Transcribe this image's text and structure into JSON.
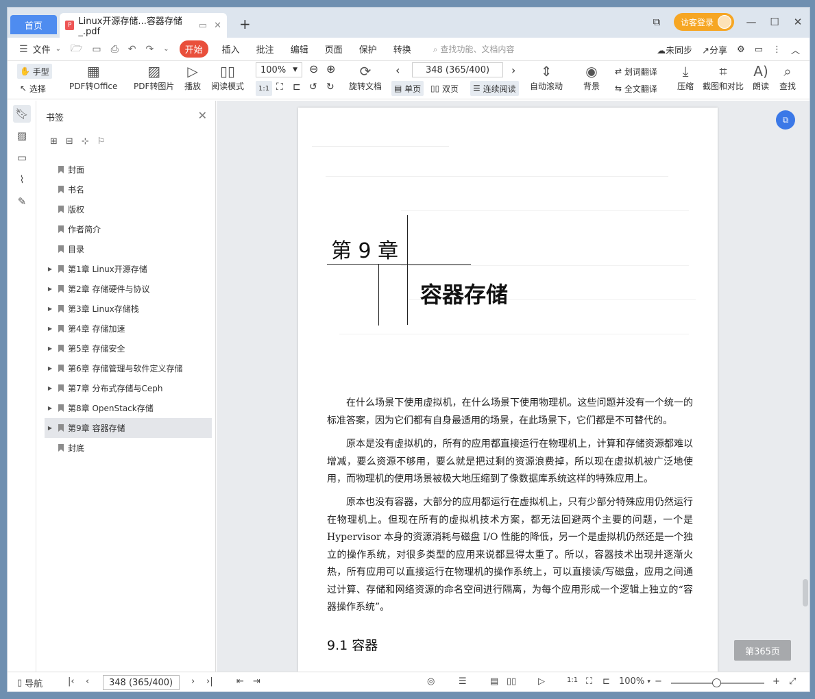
{
  "titlebar": {
    "home_tab": "首页",
    "doc_tab": "Linux开源存储...容器存储_.pdf",
    "new_tab": "+",
    "login": "访客登录"
  },
  "menubar": {
    "file": "文件",
    "start": "开始",
    "items": [
      "插入",
      "批注",
      "编辑",
      "页面",
      "保护",
      "转换"
    ],
    "search_placeholder": "查找功能、文档内容",
    "sync": "未同步",
    "share": "分享"
  },
  "toolbar": {
    "hand": "手型",
    "select": "选择",
    "pdf_to_office": "PDF转Office",
    "pdf_to_image": "PDF转图片",
    "play": "播放",
    "read_mode": "阅读模式",
    "zoom": "100%",
    "page_box": "348 (365/400)",
    "rotate_doc": "旋转文档",
    "single": "单页",
    "double": "双页",
    "continuous": "连续阅读",
    "auto_scroll": "自动滚动",
    "background": "背景",
    "word_translate": "划词翻译",
    "full_translate": "全文翻译",
    "compress": "压缩",
    "crop_compare": "截图和对比",
    "read_aloud": "朗读",
    "find": "查找",
    "one_to_one": "1:1"
  },
  "sidebar": {
    "title": "书签",
    "bookmarks": [
      {
        "label": "封面",
        "expandable": false
      },
      {
        "label": "书名",
        "expandable": false
      },
      {
        "label": "版权",
        "expandable": false
      },
      {
        "label": "作者简介",
        "expandable": false
      },
      {
        "label": "目录",
        "expandable": false
      },
      {
        "label": "第1章 Linux开源存储",
        "expandable": true
      },
      {
        "label": "第2章 存储硬件与协议",
        "expandable": true
      },
      {
        "label": "第3章 Linux存储栈",
        "expandable": true
      },
      {
        "label": "第4章 存储加速",
        "expandable": true
      },
      {
        "label": "第5章 存储安全",
        "expandable": true
      },
      {
        "label": "第6章 存储管理与软件定义存储",
        "expandable": true
      },
      {
        "label": "第7章 分布式存储与Ceph",
        "expandable": true
      },
      {
        "label": "第8章 OpenStack存储",
        "expandable": true
      },
      {
        "label": "第9章 容器存储",
        "expandable": true,
        "selected": true
      },
      {
        "label": "封底",
        "expandable": false
      }
    ]
  },
  "page": {
    "chapter_num": "第 9 章",
    "chapter_title": "容器存储",
    "paragraphs": [
      "在什么场景下使用虚拟机，在什么场景下使用物理机。这些问题并没有一个统一的标准答案，因为它们都有自身最适用的场景，在此场景下，它们都是不可替代的。",
      "原本是没有虚拟机的，所有的应用都直接运行在物理机上，计算和存储资源都难以增减，要么资源不够用，要么就是把过剩的资源浪费掉，所以现在虚拟机被广泛地使用，而物理机的使用场景被极大地压缩到了像数据库系统这样的特殊应用上。",
      "原本也没有容器，大部分的应用都运行在虚拟机上，只有少部分特殊应用仍然运行在物理机上。但现在所有的虚拟机技术方案，都无法回避两个主要的问题，一个是Hypervisor 本身的资源消耗与磁盘 I/O 性能的降低，另一个是虚拟机仍然还是一个独立的操作系统，对很多类型的应用来说都显得太重了。所以，容器技术出现并逐渐火热，所有应用可以直接运行在物理机的操作系统上，可以直接读/写磁盘，应用之间通过计算、存储和网络资源的命名空间进行隔离，为每个应用形成一个逻辑上独立的“容器操作系统”。"
    ],
    "section_title": "9.1   容器",
    "page_badge": "第365页"
  },
  "statusbar": {
    "nav": "导航",
    "page_box": "348 (365/400)",
    "zoom": "100%"
  }
}
